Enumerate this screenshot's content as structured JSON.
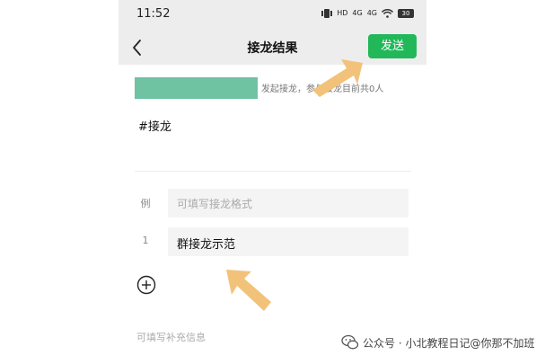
{
  "status_bar": {
    "time": "11:52",
    "icons": [
      "vibrate-icon",
      "hd-icon",
      "4g-icon",
      "4g-icon",
      "wifi-icon"
    ],
    "signal_labels": [
      "HD",
      "4G",
      "4G"
    ],
    "battery": "30"
  },
  "nav": {
    "title": "接龙结果",
    "send_label": "发送"
  },
  "initiator_text": "发起接龙，参与接龙目前共0人",
  "hashtag": "#接龙",
  "example_row": {
    "index_label": "例",
    "placeholder": "可填写接龙格式"
  },
  "entries": [
    {
      "index": "1",
      "text": "群接龙示范"
    }
  ],
  "supplement_placeholder": "可填写补充信息",
  "watermark": "公众号 · 小北教程日记@你那不加班",
  "colors": {
    "send_button": "#22b85a",
    "bar_background": "#ededed",
    "redaction": "#6fc2a2",
    "arrow": "#f2c27a"
  }
}
